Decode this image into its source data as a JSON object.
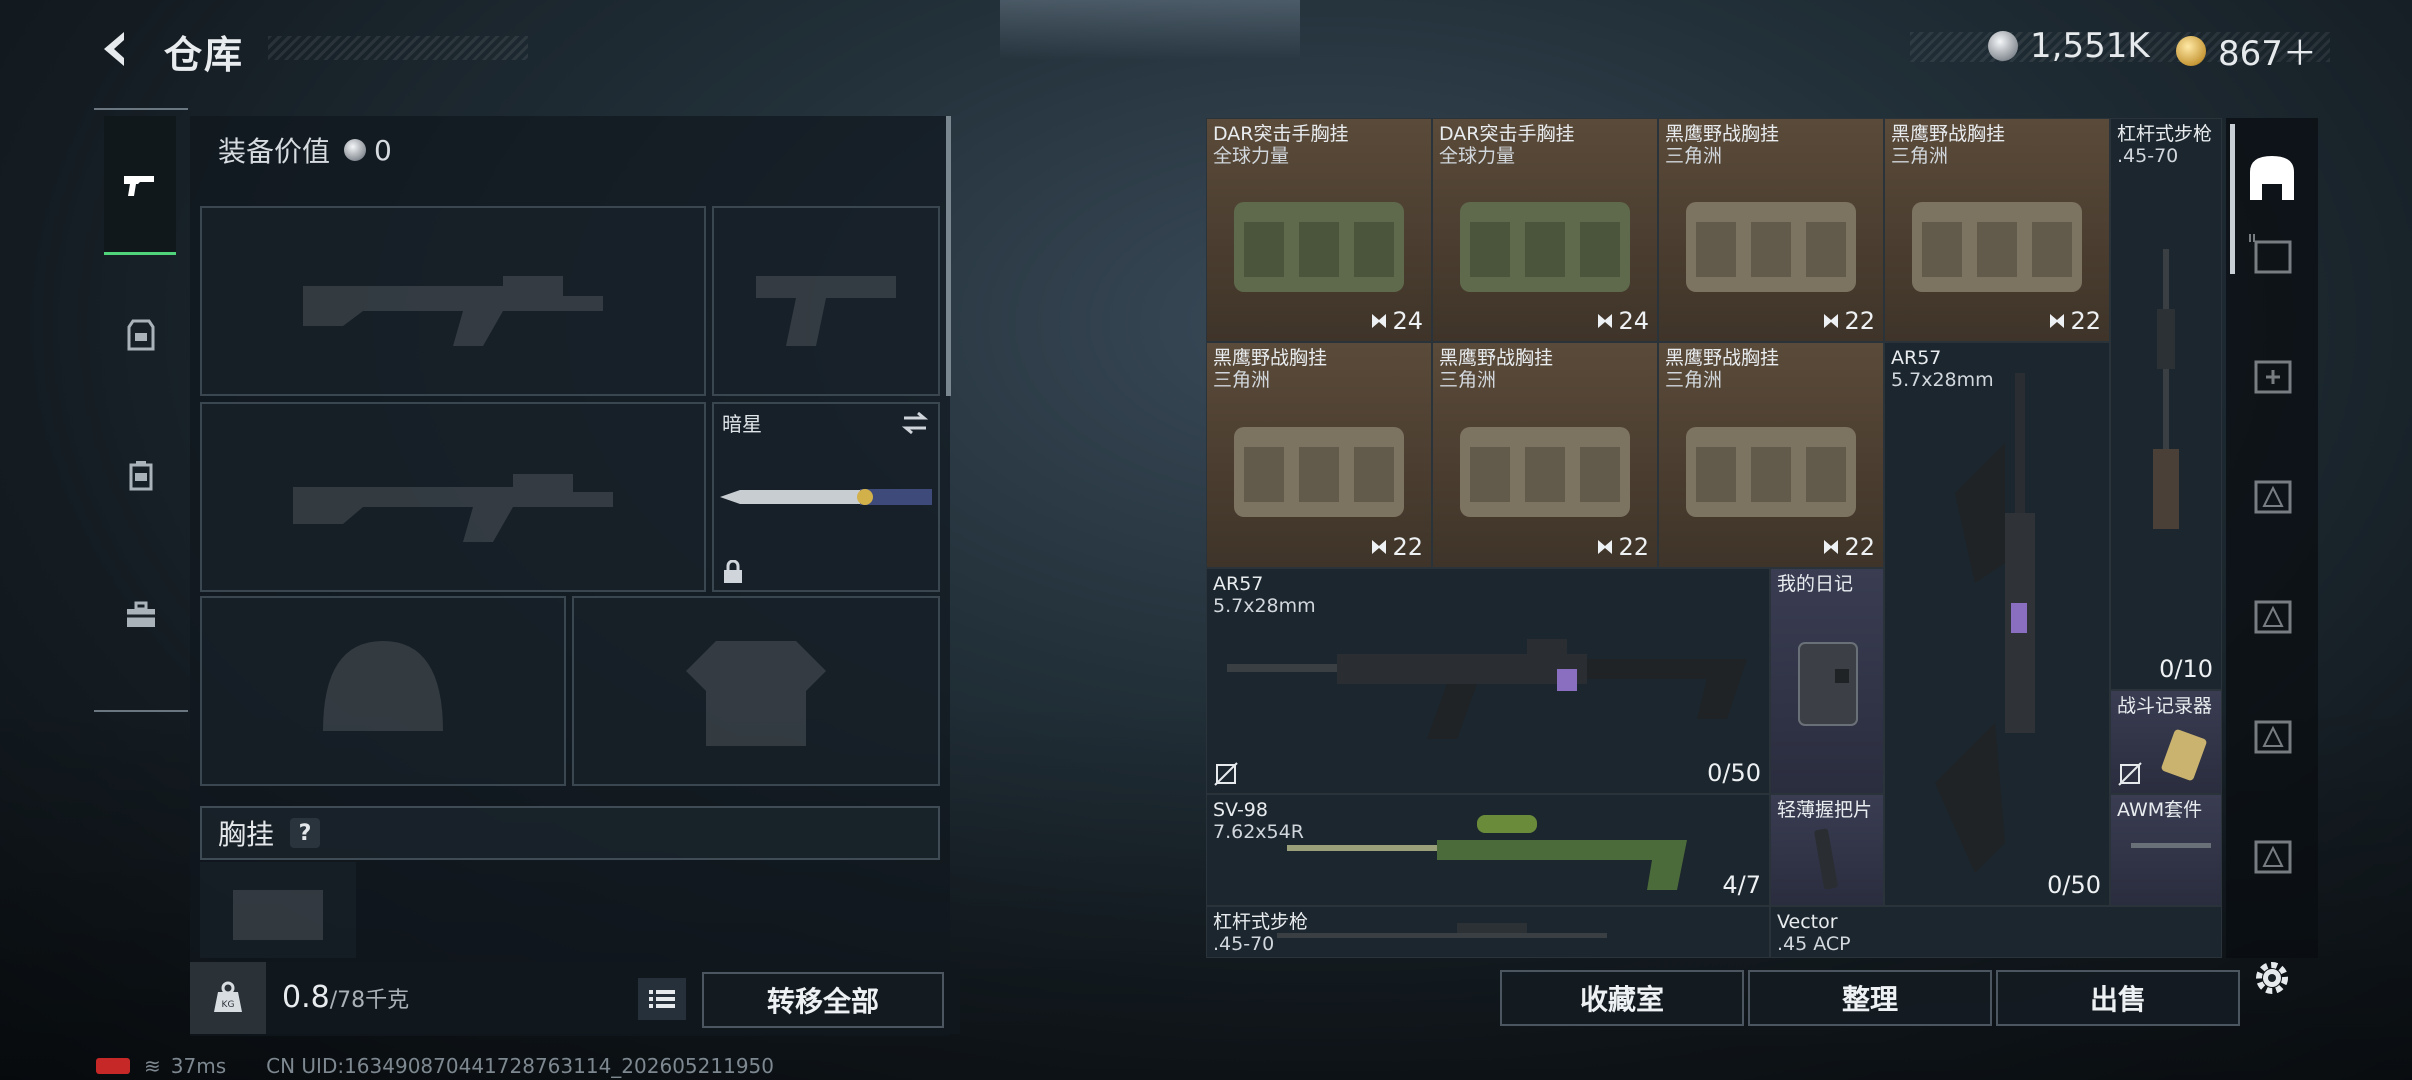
{
  "header": {
    "title": "仓库"
  },
  "currency": [
    {
      "name": "silver-coin",
      "value": "1,551K",
      "color": "#b8bec4"
    },
    {
      "name": "gold-coin",
      "value": "867＋",
      "color": "#d6a83c"
    }
  ],
  "left_rail": {
    "tabs": [
      {
        "name": "weapon-icon",
        "active": true
      },
      {
        "name": "armor-icon",
        "active": false
      },
      {
        "name": "backpack-icon",
        "active": false
      },
      {
        "name": "toolbox-icon",
        "active": false
      }
    ]
  },
  "equip": {
    "value_label": "装备价值",
    "value": "0",
    "melee_name": "暗星",
    "chest_label": "胸挂",
    "chest_help": "?"
  },
  "footer": {
    "weight_value": "0.8",
    "weight_max": "/78千克",
    "transfer_all": "转移全部",
    "collection": "收藏室",
    "sort": "整理",
    "sell": "出售"
  },
  "grid": {
    "r1": [
      {
        "name": "DAR突击手胸挂",
        "sub": "全球力量",
        "qty": "24"
      },
      {
        "name": "DAR突击手胸挂",
        "sub": "全球力量",
        "qty": "24"
      },
      {
        "name": "黑鹰野战胸挂",
        "sub": "三角洲",
        "qty": "22"
      },
      {
        "name": "黑鹰野战胸挂",
        "sub": "三角洲",
        "qty": "22"
      }
    ],
    "r2": [
      {
        "name": "黑鹰野战胸挂",
        "sub": "三角洲",
        "qty": "22"
      },
      {
        "name": "黑鹰野战胸挂",
        "sub": "三角洲",
        "qty": "22"
      },
      {
        "name": "黑鹰野战胸挂",
        "sub": "三角洲",
        "qty": "22"
      }
    ],
    "lever_rifle": {
      "name": "杠杆式步枪",
      "sub": ".45-70",
      "qty": "0/10"
    },
    "ar57_tall": {
      "name": "AR57",
      "sub": "5.7x28mm",
      "qty": "0/50"
    },
    "ar57_wide": {
      "name": "AR57",
      "sub": "5.7x28mm",
      "qty": "0/50"
    },
    "diary": {
      "name": "我的日记"
    },
    "recorder": {
      "name": "战斗记录器"
    },
    "sv98": {
      "name": "SV-98",
      "sub": "7.62x54R",
      "qty": "4/7"
    },
    "grip": {
      "name": "轻薄握把片"
    },
    "awm_kit": {
      "name": "AWM套件"
    },
    "lever_rifle2": {
      "name": "杠杆式步枪",
      "sub": ".45-70"
    },
    "vector": {
      "name": "Vector",
      "sub": ".45 ACP"
    }
  },
  "status": {
    "ping": "37ms",
    "uid": "CN UID:1634908704417287631​14_202605211950"
  },
  "colors": {
    "accent": "#4fd37b",
    "brown_cell": "#5a4a39",
    "purple_cell": "#3a3d52"
  }
}
